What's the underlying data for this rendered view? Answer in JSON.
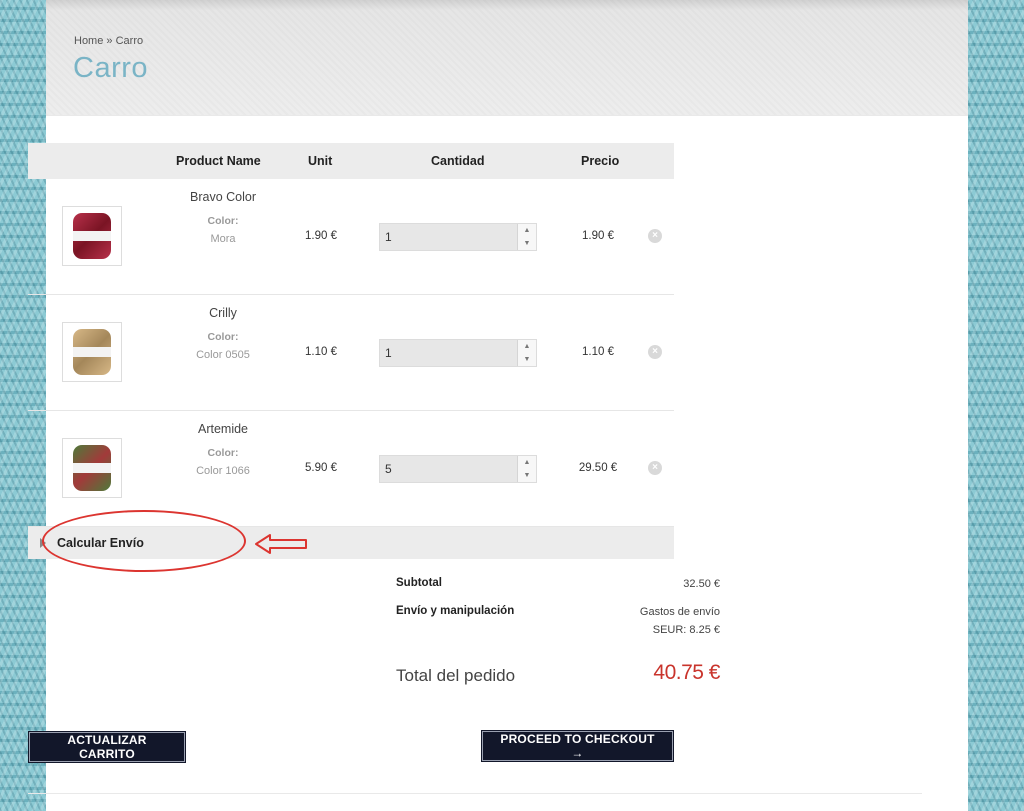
{
  "breadcrumb": {
    "home": "Home",
    "separator": "»",
    "current": "Carro"
  },
  "page_title": "Carro",
  "table": {
    "headers": {
      "name": "Product Name",
      "unit": "Unit",
      "qty": "Cantidad",
      "price": "Precio"
    },
    "rows": [
      {
        "name": "Bravo Color",
        "attr_label": "Color:",
        "attr_value": "Mora",
        "unit": "1.90 €",
        "qty": "1",
        "price": "1.90 €",
        "thumb_colors": [
          "#b8304a",
          "#7a1424"
        ]
      },
      {
        "name": "Crilly",
        "attr_label": "Color:",
        "attr_value": "Color 0505",
        "unit": "1.10 €",
        "qty": "1",
        "price": "1.10 €",
        "thumb_colors": [
          "#d7b887",
          "#a4875a"
        ]
      },
      {
        "name": "Artemide",
        "attr_label": "Color:",
        "attr_value": "Color 1066",
        "unit": "5.90 €",
        "qty": "5",
        "price": "29.50 €",
        "thumb_colors": [
          "#4e7a3a",
          "#a23a3a"
        ]
      }
    ],
    "remove_icon": "remove-icon",
    "spin_up": "▲",
    "spin_down": "▼",
    "remove_glyph": "×"
  },
  "shipping_calc": {
    "label": "Calcular Envío"
  },
  "totals": {
    "subtotal_label": "Subtotal",
    "subtotal_value": "32.50 €",
    "shipping_label": "Envío y manipulación",
    "shipping_value_line1": "Gastos de envío",
    "shipping_value_line2": "SEUR: 8.25 €",
    "total_label": "Total del pedido",
    "total_value": "40.75 €"
  },
  "buttons": {
    "update": "ACTUALIZAR CARRITO",
    "checkout": "PROCEED TO CHECKOUT →"
  },
  "colors": {
    "title": "#7ab4c6",
    "total": "#c9342c",
    "button_bg": "#12172a",
    "annotation": "#dc3530"
  }
}
